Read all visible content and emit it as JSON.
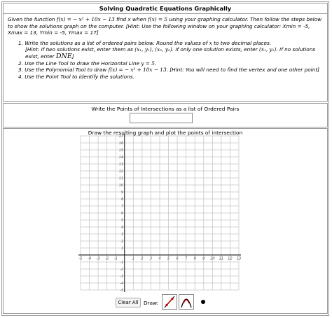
{
  "title": "Solving Quadratic Equations Graphically",
  "instructions": {
    "intro_1": "Given the function ",
    "intro_fx": "f(x) = − x² + 10x − 13",
    "intro_2": " find x when ",
    "intro_fx5": "f(x) = 5",
    "intro_3": " using your graphing calculator. Then follow the steps below to show the solutions graph on the computer. [Hint: Use the following window on your graphing calculator: Xmin = -5, Xmax = 13, Ymin = -5, Ymax = 17]",
    "step1_a": "1. Write the solutions as a list of ordered pairs below. Round the values of ",
    "step1_x": "x",
    "step1_b": " to two decimal places.",
    "step1_hint_a": "[Hint: If two solutions exist, enter them as ",
    "step1_pairs": "(x₁, y₁), (x₂, y₂)",
    "step1_hint_b": ". If only one solution exists, enter ",
    "step1_pair1": "(x₁, y₁)",
    "step1_hint_c": ". If no solutions exist, enter ",
    "step1_dne": "DNE",
    "step1_hint_d": "]",
    "step2_a": "2. Use the Line Tool to draw the Horizontal Line ",
    "step2_y": "y = 5",
    "step2_b": ".",
    "step3_a": "3. Use the Polynomial Tool to draw ",
    "step3_fx": "f(x) = − x² + 10x − 13",
    "step3_b": ". [Hint: You will need to find the vertex and one other point]",
    "step4": "4. Use the Point Tool to identify the solutions."
  },
  "answer": {
    "label": "Write the Points of Intersections as a list of Ordered Pairs",
    "value": ""
  },
  "graph": {
    "label": "Draw the resulting graph and plot the points of intersection",
    "xmin": -5,
    "xmax": 13,
    "ymin": -5,
    "ymax": 17,
    "x_ticks": [
      "-5",
      "-4",
      "-3",
      "-2",
      "-1",
      "1",
      "2",
      "3",
      "4",
      "5",
      "6",
      "7",
      "8",
      "9",
      "10",
      "11",
      "12",
      "13"
    ],
    "y_ticks": [
      "17",
      "16",
      "15",
      "14",
      "13",
      "12",
      "11",
      "10",
      "9",
      "8",
      "7",
      "6",
      "5",
      "4",
      "3",
      "2",
      "1",
      "-1",
      "-2",
      "-3",
      "-4",
      "-5"
    ]
  },
  "toolbar": {
    "clear_label": "Clear All",
    "draw_label": "Draw:",
    "tools": [
      "line-tool",
      "polynomial-tool",
      "point-tool"
    ]
  },
  "colors": {
    "border": "#9a9a9a",
    "grid": "#c8c8c8",
    "axis": "#000000",
    "line_tool": "#c00000"
  }
}
